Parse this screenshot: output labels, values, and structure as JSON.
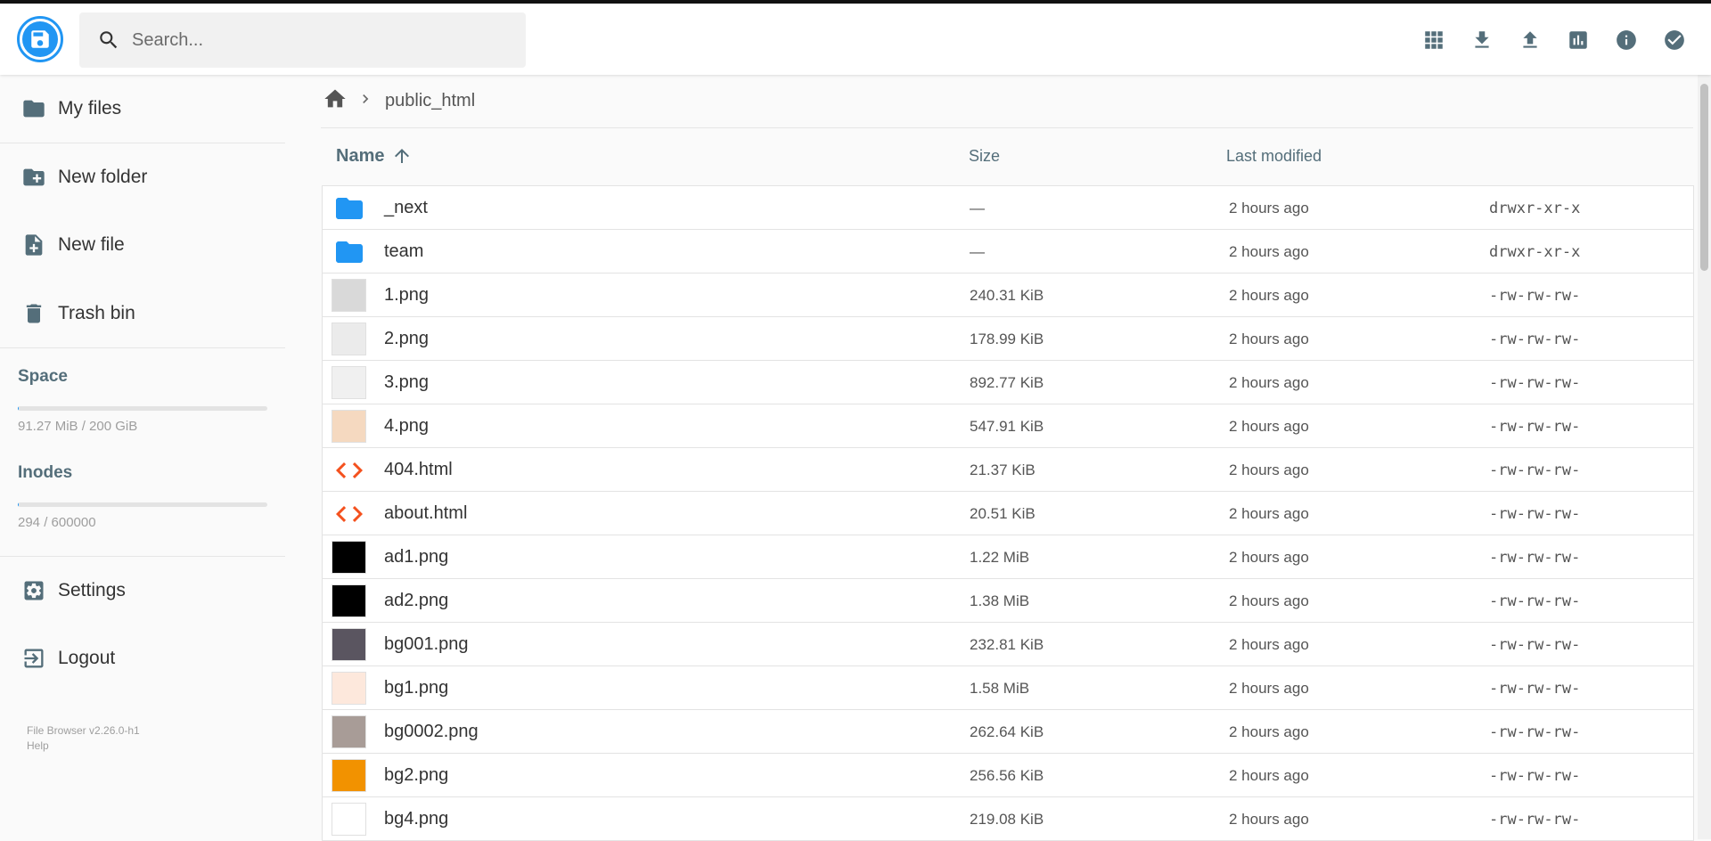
{
  "header": {
    "search_placeholder": "Search...",
    "actions": [
      "grid-view-icon",
      "download-icon",
      "upload-icon",
      "chart-icon",
      "info-icon",
      "select-icon"
    ]
  },
  "sidebar": {
    "items": [
      {
        "label": "My files",
        "icon": "folder-icon"
      },
      {
        "label": "New folder",
        "icon": "folder-plus-icon"
      },
      {
        "label": "New file",
        "icon": "file-plus-icon"
      },
      {
        "label": "Trash bin",
        "icon": "trash-icon"
      }
    ],
    "space_title": "Space",
    "space_text": "91.27 MiB / 200 GiB",
    "space_fraction": 0.0004,
    "inodes_title": "Inodes",
    "inodes_text": "294 / 600000",
    "inodes_fraction": 0.0005,
    "settings_label": "Settings",
    "logout_label": "Logout",
    "version": "File Browser v2.26.0-h1",
    "help": "Help"
  },
  "breadcrumb": {
    "current": "public_html"
  },
  "columns": {
    "name": "Name",
    "size": "Size",
    "modified": "Last modified"
  },
  "files": [
    {
      "name": "_next",
      "size": "—",
      "modified": "2 hours ago",
      "perm": "drwxr-xr-x",
      "kind": "folder"
    },
    {
      "name": "team",
      "size": "—",
      "modified": "2 hours ago",
      "perm": "drwxr-xr-x",
      "kind": "folder"
    },
    {
      "name": "1.png",
      "size": "240.31 KiB",
      "modified": "2 hours ago",
      "perm": "-rw-rw-rw-",
      "kind": "image",
      "color": "#d9d9d9"
    },
    {
      "name": "2.png",
      "size": "178.99 KiB",
      "modified": "2 hours ago",
      "perm": "-rw-rw-rw-",
      "kind": "image",
      "color": "#ebebeb"
    },
    {
      "name": "3.png",
      "size": "892.77 KiB",
      "modified": "2 hours ago",
      "perm": "-rw-rw-rw-",
      "kind": "image",
      "color": "#f0f0f0"
    },
    {
      "name": "4.png",
      "size": "547.91 KiB",
      "modified": "2 hours ago",
      "perm": "-rw-rw-rw-",
      "kind": "image",
      "color": "#f5d9c0"
    },
    {
      "name": "404.html",
      "size": "21.37 KiB",
      "modified": "2 hours ago",
      "perm": "-rw-rw-rw-",
      "kind": "code"
    },
    {
      "name": "about.html",
      "size": "20.51 KiB",
      "modified": "2 hours ago",
      "perm": "-rw-rw-rw-",
      "kind": "code"
    },
    {
      "name": "ad1.png",
      "size": "1.22 MiB",
      "modified": "2 hours ago",
      "perm": "-rw-rw-rw-",
      "kind": "image",
      "color": "#000000"
    },
    {
      "name": "ad2.png",
      "size": "1.38 MiB",
      "modified": "2 hours ago",
      "perm": "-rw-rw-rw-",
      "kind": "image",
      "color": "#000000"
    },
    {
      "name": "bg001.png",
      "size": "232.81 KiB",
      "modified": "2 hours ago",
      "perm": "-rw-rw-rw-",
      "kind": "image",
      "color": "#5a5560"
    },
    {
      "name": "bg1.png",
      "size": "1.58 MiB",
      "modified": "2 hours ago",
      "perm": "-rw-rw-rw-",
      "kind": "image",
      "color": "#fde8dc"
    },
    {
      "name": "bg0002.png",
      "size": "262.64 KiB",
      "modified": "2 hours ago",
      "perm": "-rw-rw-rw-",
      "kind": "image",
      "color": "#a89c97"
    },
    {
      "name": "bg2.png",
      "size": "256.56 KiB",
      "modified": "2 hours ago",
      "perm": "-rw-rw-rw-",
      "kind": "image",
      "color": "#f29200"
    },
    {
      "name": "bg4.png",
      "size": "219.08 KiB",
      "modified": "2 hours ago",
      "perm": "-rw-rw-rw-",
      "kind": "image",
      "color": "#ffffff"
    }
  ],
  "colors": {
    "accent": "#2196f3",
    "folder": "#2196f3",
    "code": "#f4511e",
    "icon_grey": "#546e7a"
  }
}
